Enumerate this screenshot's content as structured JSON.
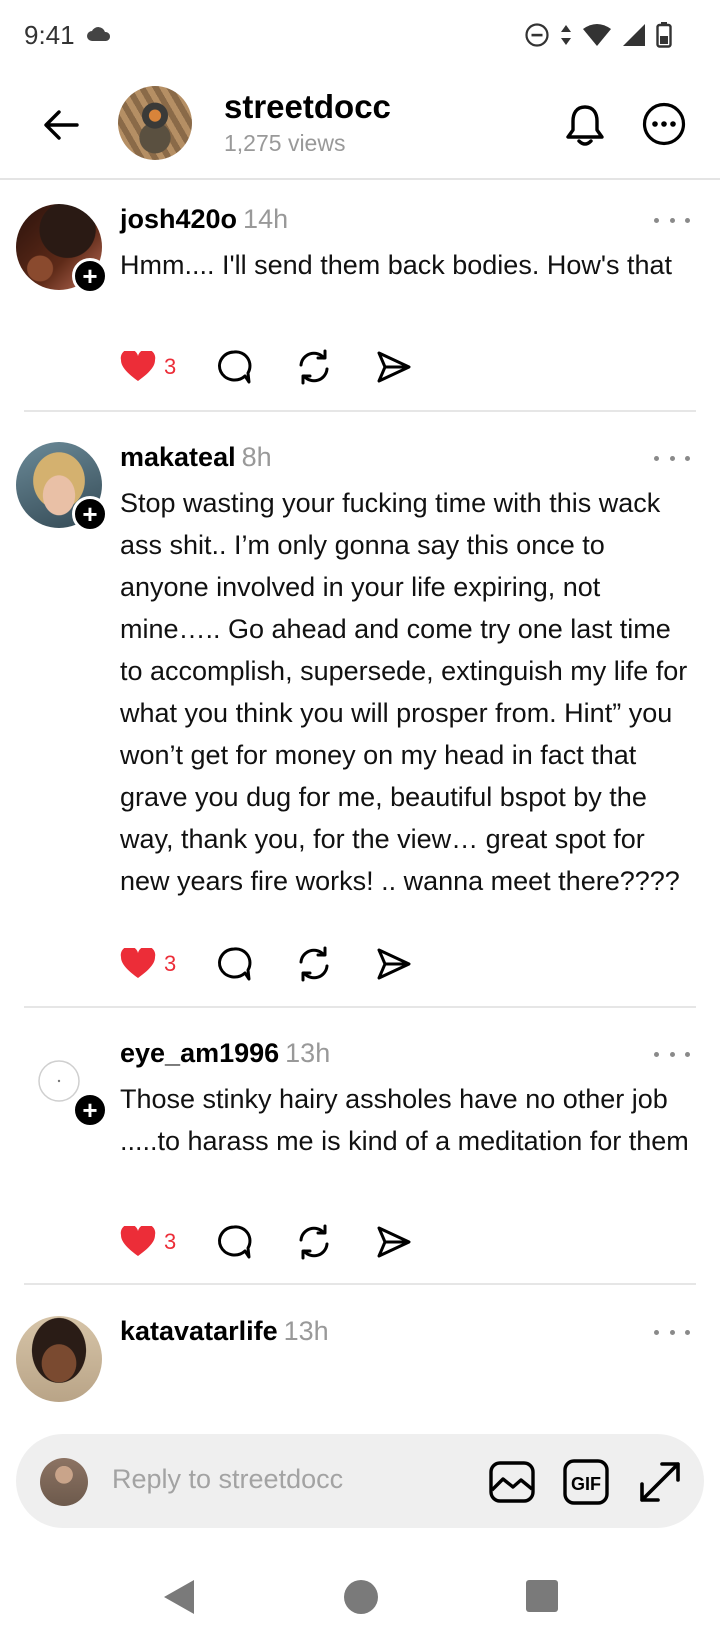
{
  "status_bar": {
    "time": "9:41"
  },
  "header": {
    "title": "streetdocc",
    "subtitle": "1,275 views"
  },
  "posts": [
    {
      "username": "josh420o",
      "time": "14h",
      "text": "Hmm.... I'll send them back bodies. How's that",
      "likes": "3"
    },
    {
      "username": "makateal",
      "time": "8h",
      "text": "Stop wasting your fucking time with this wack ass shit.. I’m only gonna say this once to anyone involved in your life expiring, not mine….. Go ahead and come try one last time to accomplish, supersede, extinguish my life for what you think you will prosper from. Hint” you won’t get for money on my head in fact that grave you dug for me, beautiful bspot by the way, thank you, for the view… great spot for new years fire works! .. wanna meet there????",
      "likes": "3"
    },
    {
      "username": "eye_am1996",
      "time": "13h",
      "text": "Those stinky hairy assholes have no other job .....to harass me is kind of a meditation for them",
      "likes": "3"
    },
    {
      "username": "katavatarlife",
      "time": "13h"
    }
  ],
  "reply": {
    "placeholder": "Reply to streetdocc",
    "gif_label": "GIF"
  },
  "colors": {
    "like": "#ec2d38",
    "muted": "#999999"
  }
}
